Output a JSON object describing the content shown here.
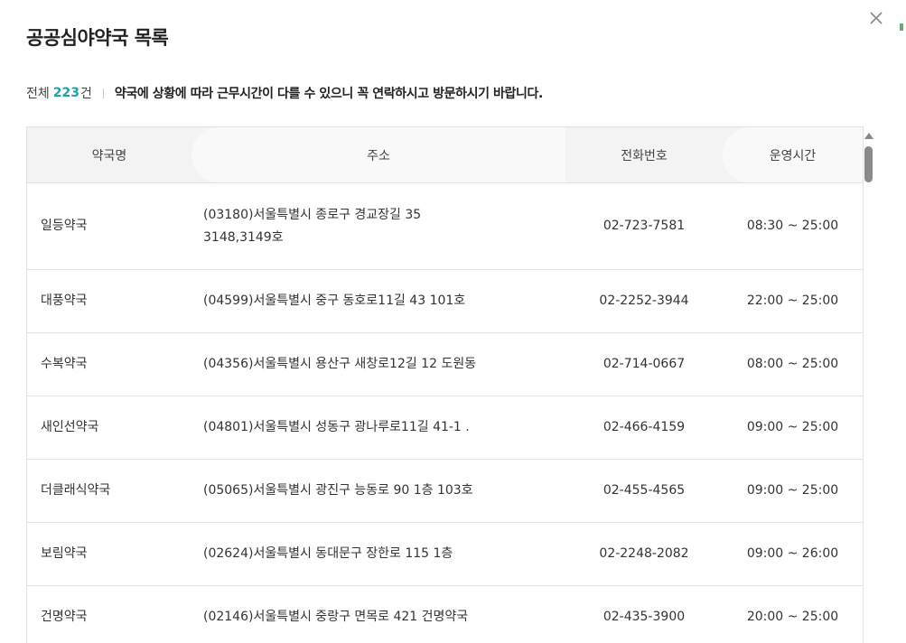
{
  "dialog": {
    "title": "공공심야약국 목록",
    "close_icon": "close-icon"
  },
  "summary": {
    "prefix": "전체",
    "count": "223",
    "unit": "건",
    "notice": "약국에 상황에 따라 근무시간이 다를 수 있으니 꼭 연락하시고 방문하시기 바랍니다."
  },
  "table": {
    "headers": [
      "약국명",
      "주소",
      "전화번호",
      "운영시간"
    ],
    "rows": [
      {
        "name": "일등약국",
        "address": "(03180)서울특별시 종로구 경교장길 35",
        "address2": "3148,3149호",
        "phone": "02-723-7581",
        "hours": "08:30 ~ 25:00"
      },
      {
        "name": "대풍약국",
        "address": "(04599)서울특별시 중구 동호로11길 43 101호",
        "phone": "02-2252-3944",
        "hours": "22:00 ~ 25:00"
      },
      {
        "name": "수복약국",
        "address": "(04356)서울특별시 용산구 새창로12길 12 도원동",
        "phone": "02-714-0667",
        "hours": "08:00 ~ 25:00"
      },
      {
        "name": "새인선약국",
        "address": "(04801)서울특별시 성동구 광나루로11길 41-1 .",
        "phone": "02-466-4159",
        "hours": "09:00 ~ 25:00"
      },
      {
        "name": "더클래식약국",
        "address": "(05065)서울특별시 광진구 능동로 90 1층 103호",
        "phone": "02-455-4565",
        "hours": "09:00 ~ 25:00"
      },
      {
        "name": "보림약국",
        "address": "(02624)서울특별시 동대문구 장한로 115 1층",
        "phone": "02-2248-2082",
        "hours": "09:00 ~ 26:00"
      },
      {
        "name": "건명약국",
        "address": "(02146)서울특별시 중랑구 면목로 421 건명약국",
        "phone": "02-435-3900",
        "hours": "20:00 ~ 25:00"
      }
    ]
  },
  "colors": {
    "accent": "#1aa3a3",
    "header_bg": "#f3f3f3",
    "border": "#e3e3e3"
  }
}
